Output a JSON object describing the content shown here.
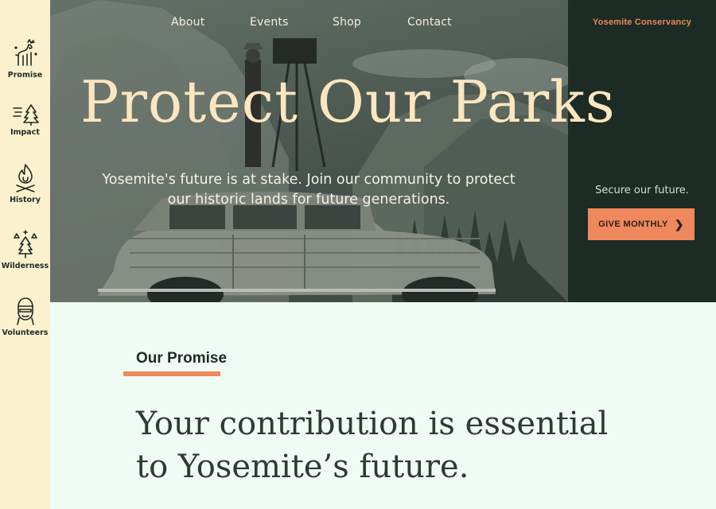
{
  "sidebar": {
    "items": [
      {
        "label": "Promise",
        "icon": "deer-icon"
      },
      {
        "label": "Impact",
        "icon": "tree-wind-icon"
      },
      {
        "label": "History",
        "icon": "campfire-icon"
      },
      {
        "label": "Wilderness",
        "icon": "pine-trees-icon"
      },
      {
        "label": "Volunteers",
        "icon": "volunteer-person-icon"
      }
    ]
  },
  "nav": {
    "links": [
      "About",
      "Events",
      "Shop",
      "Contact"
    ]
  },
  "brand": "Yosemite Conservancy",
  "hero": {
    "title": "Protect Our Parks",
    "subtitle": "Yosemite's future is at stake. Join our community to protect our historic lands for future generations."
  },
  "panel": {
    "secure_text": "Secure our future.",
    "give_label": "GIVE MONTHLY",
    "give_icon": "chevron-right-icon"
  },
  "promise": {
    "label": "Our Promise",
    "headline": "Your contribution is essential to Yosemite’s future."
  },
  "colors": {
    "accent": "#f0885d",
    "sidebar_bg": "#fbf1cf",
    "panel_bg": "#1c2b24",
    "title_cream": "#fbe6bf",
    "page_bg": "#eefcf4"
  }
}
